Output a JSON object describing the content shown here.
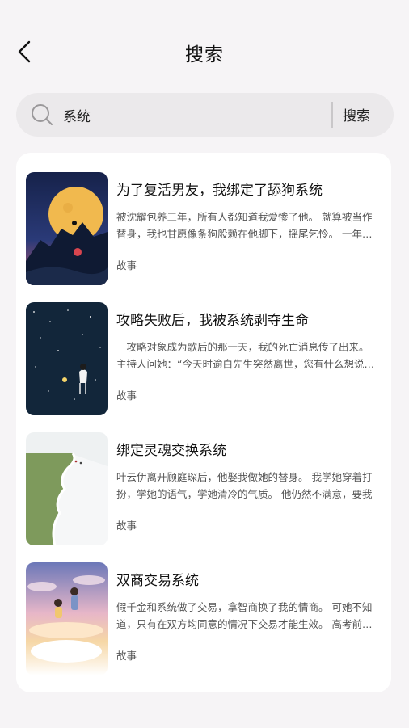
{
  "header": {
    "title": "搜索"
  },
  "search": {
    "value": "系统",
    "button_label": "搜索"
  },
  "results": [
    {
      "title": "为了复活男友，我绑定了舔狗系统",
      "desc": "被沈耀包养三年，所有人都知道我爱惨了他。 就算被当作替身，我也甘愿像条狗般赖在他脚下，摇尾乞怜。 一年前沈耀",
      "tag": "故事",
      "cover": "moon-night-cover"
    },
    {
      "title": "攻略失败后，我被系统剥夺生命",
      "desc": "　攻略对象成为歌后的那一天，我的死亡消息传了出来。　　主持人问她：“今天时逾白先生突然离世，您有什么想说的吗",
      "tag": "故事",
      "cover": "starry-girl-cover"
    },
    {
      "title": "绑定灵魂交换系统",
      "desc": "叶云伊离开顾庭琛后，他娶我做她的替身。 我学她穿着打扮，学她的语气，学她清冷的气质。 他仍然不满意，要我",
      "tag": "故事",
      "cover": "cliff-sea-cover"
    },
    {
      "title": "双商交易系统",
      "desc": "假千金和系统做了交易，拿智商换了我的情商。 可她不知道，只有在双方均同意的情况下交易才能生效。 高考前夕，她",
      "tag": "故事",
      "cover": "sunset-couple-cover"
    }
  ]
}
